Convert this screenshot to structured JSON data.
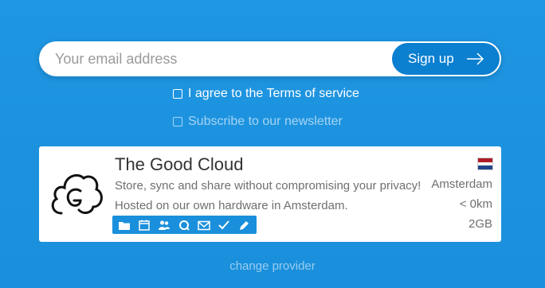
{
  "form": {
    "email_placeholder": "Your email address",
    "signup_label": "Sign up",
    "terms_label": "I agree to the Terms of service",
    "newsletter_label": "Subscribe to our newsletter"
  },
  "provider": {
    "name": "The Good Cloud",
    "description": "Store, sync and share without compromising your privacy! Hosted on our own hardware in Amsterdam.",
    "location": "Amsterdam",
    "distance": "< 0km",
    "storage": "2GB",
    "flag": "netherlands-flag",
    "features": [
      "folder-icon",
      "calendar-icon",
      "contacts-icon",
      "talk-icon",
      "mail-icon",
      "tasks-icon",
      "notes-icon"
    ]
  },
  "change_provider_label": "change provider",
  "colors": {
    "background": "#1a8fdc",
    "accent": "#0b7fd0"
  }
}
